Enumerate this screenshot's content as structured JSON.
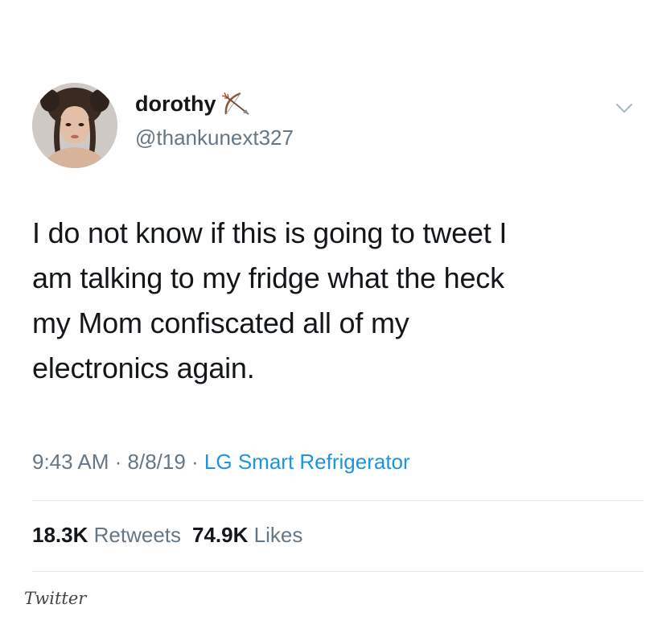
{
  "user": {
    "display_name": "dorothy",
    "handle": "@thankunext327",
    "name_emoji": "bow-and-arrow-emoji",
    "avatar": "profile-photo"
  },
  "tweet": {
    "lines": [
      "I do not know if this is going to tweet I",
      "am talking to my fridge what the heck",
      "my Mom confiscated all of my",
      "electronics again."
    ],
    "time": "9:43 AM",
    "separator1": " · ",
    "date": "8/8/19",
    "separator2": " · ",
    "source": "LG Smart Refrigerator"
  },
  "stats": {
    "retweets_count": "18.3K",
    "retweets_label": "Retweets",
    "likes_count": "74.9K",
    "likes_label": "Likes"
  },
  "watermark": "Twitter",
  "colors": {
    "text": "#14171a",
    "secondary": "#657786",
    "link": "#1b95e0",
    "divider": "#e1e8ed"
  },
  "icons": {
    "menu": "chevron-down-icon"
  }
}
